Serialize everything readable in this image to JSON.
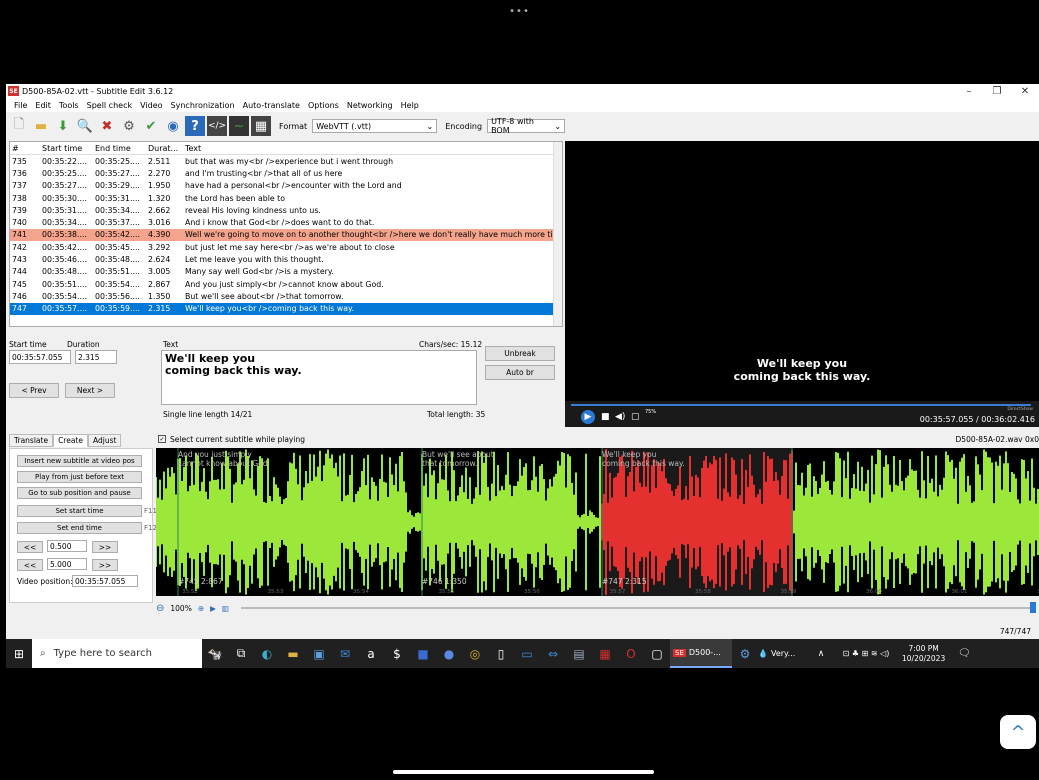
{
  "window": {
    "title": "D500-85A-02.vtt - Subtitle Edit 3.6.12",
    "app_icon": "SE",
    "controls": [
      "–",
      "❐",
      "✕"
    ]
  },
  "menu": [
    "File",
    "Edit",
    "Tools",
    "Spell check",
    "Video",
    "Synchronization",
    "Auto-translate",
    "Options",
    "Networking",
    "Help"
  ],
  "toolbar": {
    "format_label": "Format",
    "format_value": "WebVTT (.vtt)",
    "encoding_label": "Encoding",
    "encoding_value": "UTF-8 with BOM"
  },
  "list": {
    "headers": [
      "#",
      "Start time",
      "End time",
      "Durat...",
      "Text"
    ],
    "rows": [
      [
        "735",
        "00:35:22....",
        "00:35:25....",
        "2.511",
        "but that was my<br />experience but i went through"
      ],
      [
        "736",
        "00:35:25....",
        "00:35:27....",
        "2.270",
        "and I'm trusting<br />that all of us here"
      ],
      [
        "737",
        "00:35:27....",
        "00:35:29....",
        "1.950",
        "have had a personal<br />encounter with the Lord and"
      ],
      [
        "738",
        "00:35:30....",
        "00:35:31....",
        "1.320",
        "the Lord has been able to"
      ],
      [
        "739",
        "00:35:31....",
        "00:35:34....",
        "2.662",
        "reveal His loving kindness unto us."
      ],
      [
        "740",
        "00:35:34....",
        "00:35:37....",
        "3.016",
        "And i know that God<br />does want to do that."
      ],
      [
        "741",
        "00:35:38....",
        "00:35:42....",
        "4.390",
        "Well we're going to move on to another thought<br />here we don't really have much more ti..."
      ],
      [
        "742",
        "00:35:42....",
        "00:35:45....",
        "3.292",
        "but just let me say here<br />as we're about to close"
      ],
      [
        "743",
        "00:35:46....",
        "00:35:48....",
        "2.624",
        "Let me leave you with this thought."
      ],
      [
        "744",
        "00:35:48....",
        "00:35:51....",
        "3.005",
        "Many say well God<br />is a mystery."
      ],
      [
        "745",
        "00:35:51....",
        "00:35:54....",
        "2.867",
        "And you just simply<br />cannot know about God."
      ],
      [
        "746",
        "00:35:54....",
        "00:35:56....",
        "1.350",
        "But we'll see about<br />that tomorrow."
      ],
      [
        "747",
        "00:35:57....",
        "00:35:59....",
        "2.315",
        "We'll keep you<br />coming back this way."
      ]
    ]
  },
  "video": {
    "subtitle_line1": "We'll keep you",
    "subtitle_line2": "coming back this way.",
    "time": "00:35:57.055 / 00:36:02.416",
    "volume": "75%",
    "renderer": "DirectShow"
  },
  "edit": {
    "start_time_label": "Start time",
    "duration_label": "Duration",
    "start_time": "00:35:57.055",
    "duration": "2.315",
    "text_label": "Text",
    "chars_sec": "Chars/sec: 15.12",
    "text_line1": "We'll keep you",
    "text_line2": "coming back this way.",
    "unbreak": "Unbreak",
    "auto_br": "Auto br",
    "prev": "< Prev",
    "next": "Next >",
    "single_line_length": "Single line length 14/21",
    "total_length": "Total length: 35"
  },
  "tabs": [
    "Translate",
    "Create",
    "Adjust"
  ],
  "create": {
    "insert": "Insert new subtitle at video pos",
    "play_before": "Play from just before text",
    "goto_sub": "Go to sub position and pause",
    "set_start": "Set start time",
    "set_start_key": "F11",
    "set_end": "Set end time",
    "set_end_key": "F12",
    "back": "<<",
    "fwd": ">>",
    "step1": "0.500",
    "step2": "5.000",
    "video_pos_label": "Video position:",
    "video_pos": "00:35:57.055"
  },
  "waveform": {
    "select_current": "Select current subtitle while playing",
    "file": "D500-85A-02.wav 0x0",
    "seg745_l1": "And you just simply",
    "seg745_l2": "cannot know about God.",
    "seg745_info": "#745  2:867",
    "seg746_l1": "But we'll see about",
    "seg746_l2": "that tomorrow.",
    "seg746_info": "#746  1:350",
    "seg747_l1": "We'll keep you",
    "seg747_l2": "coming back this way.",
    "seg747_info": "#747  2:315",
    "ticks": [
      "35:52",
      "35:53",
      "35:54",
      "35:55",
      "35:56",
      "35:57",
      "35:58",
      "35:59",
      "36:00",
      "36:01",
      "36:02"
    ],
    "zoom": "100%",
    "colors": {
      "normal": "#9be83b",
      "selected": "#e53030"
    }
  },
  "status": {
    "count": "747/747"
  },
  "taskbar": {
    "search_placeholder": "Type here to search",
    "se_app": "D500-...",
    "weather": "Very...",
    "time": "7:00 PM",
    "date": "10/20/2023",
    "notif": "3"
  },
  "ios": {
    "more_dots": "•••",
    "scroll_up": "^"
  }
}
